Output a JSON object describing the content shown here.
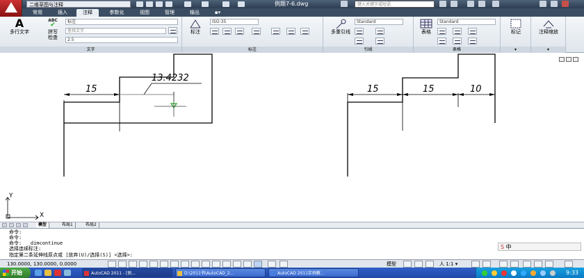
{
  "titlebar": {
    "workspace": "二维草图与注释",
    "document_title": "例题7-6.dwg",
    "search_placeholder": "键入关键字或短语"
  },
  "ribbon_tabs": [
    "常用",
    "插入",
    "注释",
    "参数化",
    "视图",
    "管理",
    "输出"
  ],
  "active_tab": "注释",
  "ribbon": {
    "text_panel": {
      "label": "文字",
      "mtext": "多行文字",
      "spell_line1": "拼写",
      "spell_line2": "检查",
      "style_value": "标注",
      "find_placeholder": "查找文字",
      "height_value": "2.5"
    },
    "dim_panel": {
      "label": "标注",
      "dim_button": "标注",
      "dimstyle_value": "ISO-35"
    },
    "leader_panel": {
      "label": "引线",
      "mleader_button": "多重引线",
      "mleader_style": "Standard"
    },
    "table_panel": {
      "label": "表格",
      "table_button": "表格",
      "table_style": "Standard"
    },
    "markup_panel": {
      "markup_button": "标记"
    },
    "scale_panel": {
      "scale_button": "注释缩放"
    }
  },
  "drawing": {
    "left_dim_a": "15",
    "left_dim_b": "13.4232",
    "right_dim_a": "15",
    "right_dim_b": "15",
    "right_dim_c": "10",
    "ucs_y": "Y",
    "ucs_x": "X"
  },
  "layout_tabs": [
    "模型",
    "布局1",
    "布局2"
  ],
  "active_layout": "模型",
  "command_history": [
    "命令:",
    "命令:",
    "命令:  _dimcontinue",
    "选择连续标注:",
    "指定第二条延伸线原点或 [放弃(U)/选择(S)] <选择>:"
  ],
  "ime": "中",
  "status": {
    "coordinates": "130.0000, 130.0000, 0.0000",
    "model": "模型",
    "annotation_scale": "人 1:1 ▾"
  },
  "taskbar": {
    "start": "开始",
    "tasks": [
      "AutoCAD 2011 - [例...",
      "D:\\2011书\\AutoCAD_2...",
      "AutoCAD 2011实例教..."
    ],
    "clock": "9:33"
  }
}
